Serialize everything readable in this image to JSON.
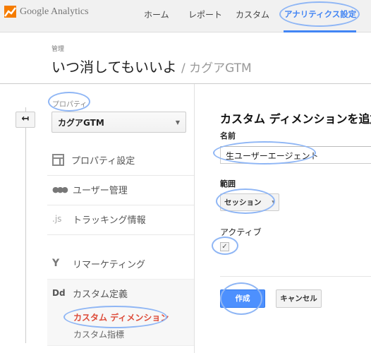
{
  "header": {
    "logo_text": "Google Analytics",
    "nav": [
      "ホーム",
      "レポート",
      "カスタム",
      "アナリティクス設定"
    ],
    "active_nav": "アナリティクス設定",
    "accent": "#4285f4"
  },
  "breadcrumb": "管理",
  "title": {
    "account": "いつ消してもいいよ",
    "property": "/ カグアGTM"
  },
  "sidebar": {
    "property_label": "プロパティ",
    "property_select": "カグアGTM",
    "items": [
      {
        "label": "プロパティ設定",
        "icon": "layout-icon"
      },
      {
        "label": "ユーザー管理",
        "icon": "users-icon"
      },
      {
        "label": "トラッキング情報",
        "icon": "js-icon"
      },
      {
        "label": "リマーケティング",
        "icon": "fork-icon"
      },
      {
        "label": "カスタム定義",
        "icon": "dd-icon"
      }
    ],
    "subitems": [
      {
        "label": "カスタム ディメンション",
        "active": true
      },
      {
        "label": "カスタム指標",
        "active": false
      }
    ],
    "active_color": "#dd4b39"
  },
  "form": {
    "heading": "カスタム ディメンションを追加",
    "name_label": "名前",
    "name_value": "生ユーザーエージェント",
    "scope_label": "範囲",
    "scope_value": "セッション",
    "active_label": "アクティブ",
    "active_checked": true,
    "create_label": "作成",
    "cancel_label": "キャンセル",
    "primary_color": "#4d90fe"
  }
}
